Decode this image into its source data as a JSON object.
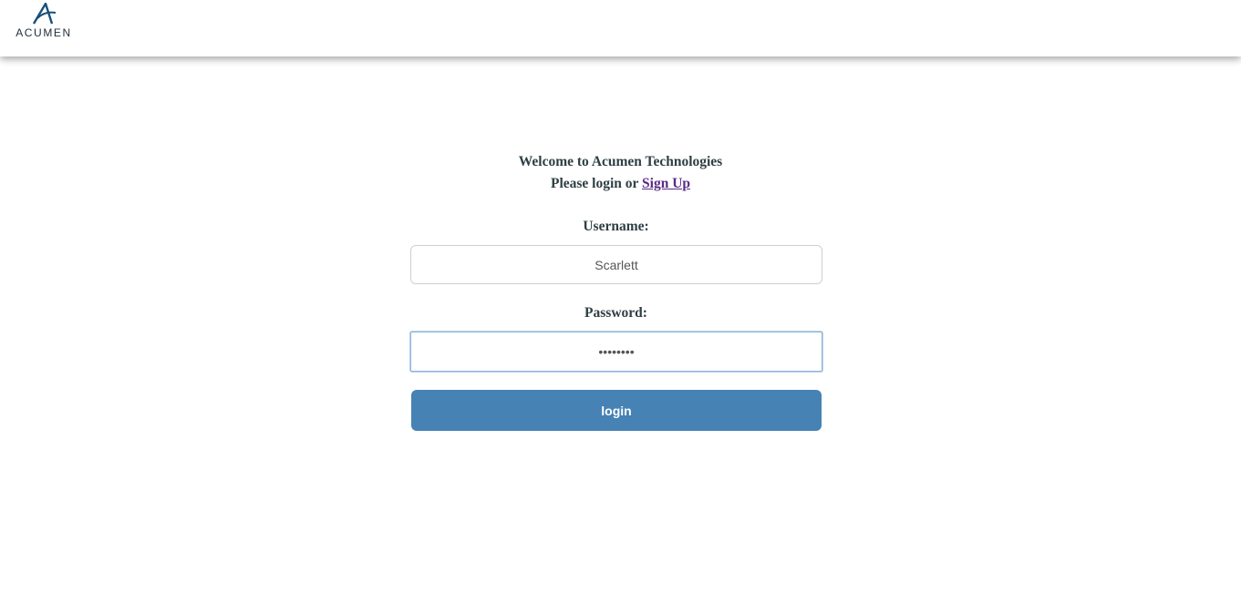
{
  "header": {
    "logo_text": "ACUMEN",
    "logo_icon": "acumen-a-logo-icon"
  },
  "welcome": {
    "line1": "Welcome to Acumen Technologies",
    "line2_prefix": "Please login or ",
    "signup_link": "Sign Up"
  },
  "form": {
    "username_label": "Username:",
    "username_value": "Scarlett",
    "password_label": "Password:",
    "password_value": "••••••••",
    "login_button": "login"
  },
  "colors": {
    "button": "#4682b4",
    "link": "#5a2a86",
    "text": "#2f3f44"
  }
}
